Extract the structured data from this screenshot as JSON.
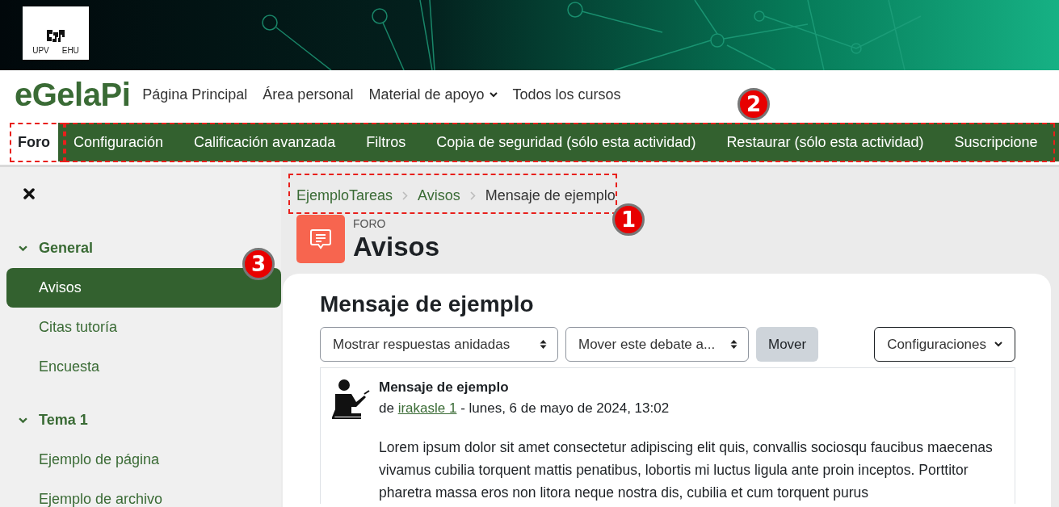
{
  "logo": {
    "texts": [
      "UPV",
      "EHU"
    ]
  },
  "brand": "eGelaPi",
  "primary_nav": [
    {
      "label": "Página Principal",
      "kind": "link"
    },
    {
      "label": "Área personal",
      "kind": "link"
    },
    {
      "label": "Material de apoyo",
      "kind": "dropdown"
    },
    {
      "label": "Todos los cursos",
      "kind": "link"
    }
  ],
  "secondary_nav": [
    {
      "label": "Foro",
      "selected": true
    },
    {
      "label": "Configuración",
      "selected": false
    },
    {
      "label": "Calificación avanzada",
      "selected": false
    },
    {
      "label": "Filtros",
      "selected": false
    },
    {
      "label": "Copia de seguridad (sólo esta actividad)",
      "selected": false
    },
    {
      "label": "Restaurar (sólo esta actividad)",
      "selected": false
    },
    {
      "label": "Suscripcione",
      "selected": false
    }
  ],
  "sidebar": {
    "sections": [
      {
        "title": "General",
        "expanded": true,
        "items": [
          {
            "label": "Avisos",
            "selected": true
          },
          {
            "label": "Citas tutoría",
            "selected": false
          },
          {
            "label": "Encuesta",
            "selected": false
          }
        ]
      },
      {
        "title": "Tema 1",
        "expanded": true,
        "items": [
          {
            "label": "Ejemplo de página",
            "selected": false
          },
          {
            "label": "Ejemplo de archivo",
            "selected": false
          }
        ]
      }
    ]
  },
  "breadcrumb": [
    {
      "label": "EjemploTareas",
      "kind": "link"
    },
    {
      "label": "Avisos",
      "kind": "link"
    },
    {
      "label": "Mensaje de ejemplo",
      "kind": "current"
    }
  ],
  "activity": {
    "type_label": "FORO",
    "title": "Avisos"
  },
  "discussion": {
    "title": "Mensaje de ejemplo",
    "display_select": "Mostrar respuestas anidadas",
    "move_select": "Mover este debate a...",
    "move_button": "Mover",
    "settings_menu": "Configuraciones"
  },
  "post": {
    "subject": "Mensaje de ejemplo",
    "by": "de",
    "author": "irakasle 1",
    "date": " - lunes, 6 de mayo de 2024, 13:02",
    "body": "Lorem ipsum dolor sit amet consectetur adipiscing elit quis, convallis sociosqu faucibus maecenas vivamus cubilia torquent mattis penatibus, lobortis mi luctus ligula ante proin inceptos. Porttitor pharetra massa eros non litora neque nostra dis, cubilia et cum torquent purus"
  },
  "annotations": [
    {
      "number": "1"
    },
    {
      "number": "2"
    },
    {
      "number": "3"
    }
  ]
}
